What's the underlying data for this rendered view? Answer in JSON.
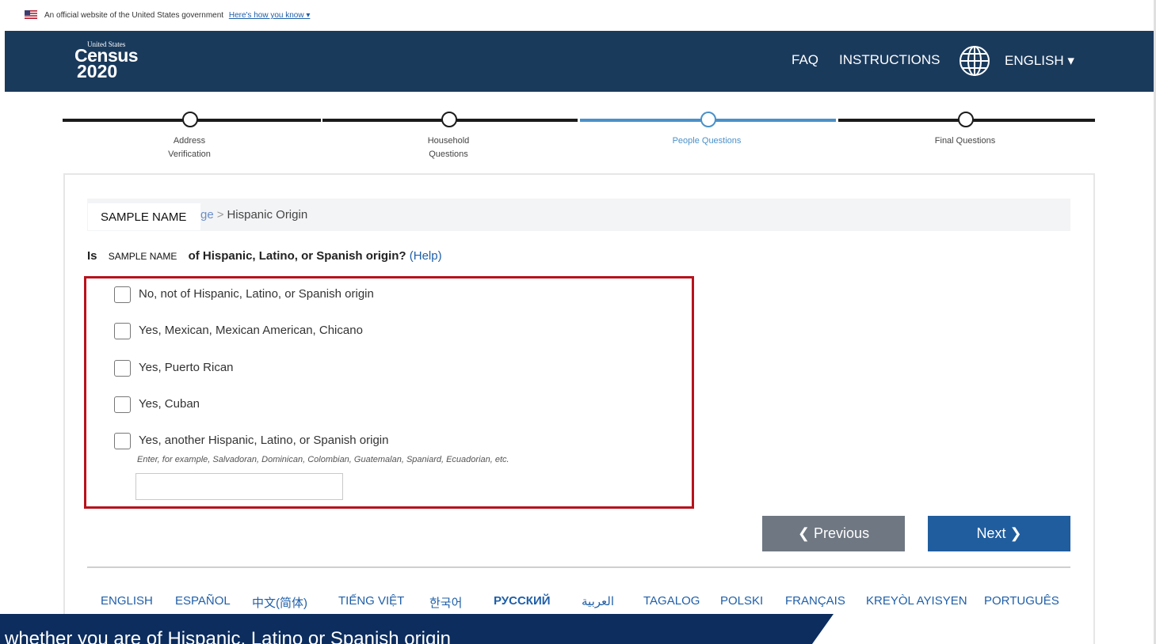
{
  "gov_banner": {
    "text": "An official website of the United States government",
    "link": "Here's how you know ▾"
  },
  "header": {
    "logo": {
      "top": "United States",
      "mid": "Census",
      "year": "2020"
    },
    "nav": {
      "faq": "FAQ",
      "instructions": "INSTRUCTIONS",
      "language": "ENGLISH ▾"
    }
  },
  "progress": {
    "steps": [
      {
        "line1": "Address",
        "line2": "Verification",
        "state": "complete"
      },
      {
        "line1": "Household",
        "line2": "Questions",
        "state": "complete"
      },
      {
        "line1": "People Questions",
        "line2": "",
        "state": "current"
      },
      {
        "line1": "Final Questions",
        "line2": "",
        "state": "pending"
      }
    ],
    "active_color": "#4a90c8",
    "done_color": "#1b1b1b"
  },
  "breadcrumb": {
    "name": "SAMPLE NAME",
    "partial": "ge",
    "separator": ">",
    "current": "Hispanic Origin"
  },
  "question": {
    "prefix": "Is",
    "name": "SAMPLE NAME",
    "text": "of Hispanic, Latino, or Spanish origin?",
    "help": "(Help)"
  },
  "options": [
    "No, not of Hispanic, Latino, or Spanish origin",
    "Yes, Mexican, Mexican American, Chicano",
    "Yes, Puerto Rican",
    "Yes, Cuban",
    "Yes, another Hispanic, Latino, or Spanish origin"
  ],
  "other_hint": "Enter, for example, Salvadoran, Dominican, Colombian, Guatemalan, Spaniard, Ecuadorian, etc.",
  "other_value": "",
  "buttons": {
    "previous": "Previous",
    "next": "Next"
  },
  "languages": [
    "ENGLISH",
    "ESPAÑOL",
    "中文(简体)",
    "TIẾNG VIỆT",
    "한국어",
    "РУССКИЙ",
    "العربية",
    "TAGALOG",
    "POLSKI",
    "FRANÇAIS",
    "KREYÒL AYISYEN",
    "PORTUGUÊS"
  ],
  "caption": "whether you are of Hispanic, Latino or Spanish origin",
  "colors": {
    "header": "#1a3a5c",
    "highlight": "#b8121c",
    "next": "#205d9e",
    "previous": "#6f7782",
    "caption": "#0c2d5e"
  }
}
